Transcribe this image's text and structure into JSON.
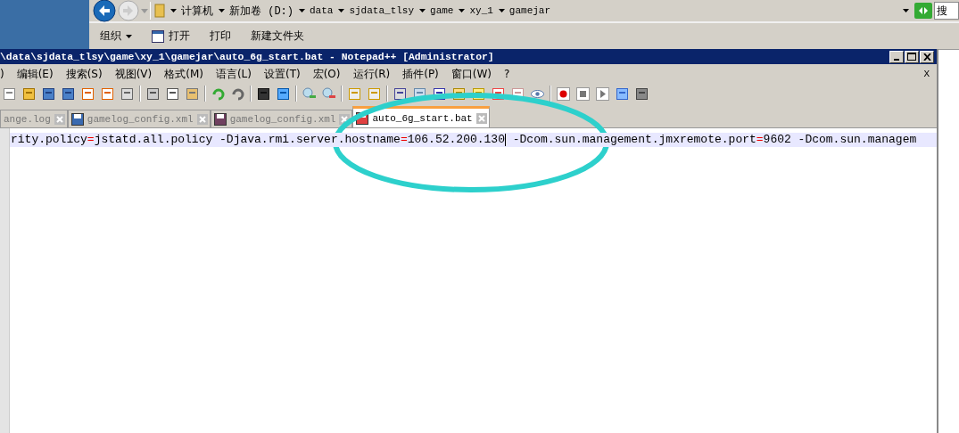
{
  "explorer": {
    "breadcrumb": [
      {
        "label": "计算机"
      },
      {
        "label": "新加卷 (D:)"
      },
      {
        "label": "data"
      },
      {
        "label": "sjdata_tlsy"
      },
      {
        "label": "game"
      },
      {
        "label": "xy_1"
      },
      {
        "label": "gamejar"
      }
    ],
    "search": {
      "placeholder": "搜"
    },
    "commands": [
      {
        "label": "组织",
        "kind": "menu"
      },
      {
        "label": "打开",
        "kind": "icon"
      },
      {
        "label": "打印",
        "kind": "plain"
      },
      {
        "label": "新建文件夹",
        "kind": "plain"
      }
    ]
  },
  "window": {
    "title": "\\data\\sjdata_tlsy\\game\\xy_1\\gamejar\\auto_6g_start.bat - Notepad++ [Administrator]"
  },
  "menu": [
    {
      "label": ")"
    },
    {
      "label": "编辑(E)"
    },
    {
      "label": "搜索(S)"
    },
    {
      "label": "视图(V)"
    },
    {
      "label": "格式(M)"
    },
    {
      "label": "语言(L)"
    },
    {
      "label": "设置(T)"
    },
    {
      "label": "宏(O)"
    },
    {
      "label": "运行(R)"
    },
    {
      "label": "插件(P)"
    },
    {
      "label": "窗口(W)"
    },
    {
      "label": "?"
    }
  ],
  "menu_close": "X",
  "tabs": [
    {
      "label": "ange.log",
      "selected": false
    },
    {
      "label": "gamelog_config.xml",
      "selected": false,
      "color": "#3a6ab0"
    },
    {
      "label": "gamelog_config.xml",
      "selected": false,
      "color": "#704060"
    },
    {
      "label": "auto_6g_start.bat",
      "selected": true,
      "color": "#e04040"
    }
  ],
  "editor": {
    "lines": [
      {
        "tokens": [
          {
            "kind": "text",
            "text": "rity.policy"
          },
          {
            "kind": "operator",
            "text": "="
          },
          {
            "kind": "text",
            "text": "jstatd.all.policy -Djava.rmi.server.hostname"
          },
          {
            "kind": "operator",
            "text": "="
          },
          {
            "kind": "text",
            "text": "106.52.200.130"
          },
          {
            "kind": "caret"
          },
          {
            "kind": "text",
            "text": " -Dcom.sun.management.jmxremote.port"
          },
          {
            "kind": "operator",
            "text": "="
          },
          {
            "kind": "text",
            "text": "9602 -Dcom.sun.managem"
          }
        ]
      }
    ]
  }
}
